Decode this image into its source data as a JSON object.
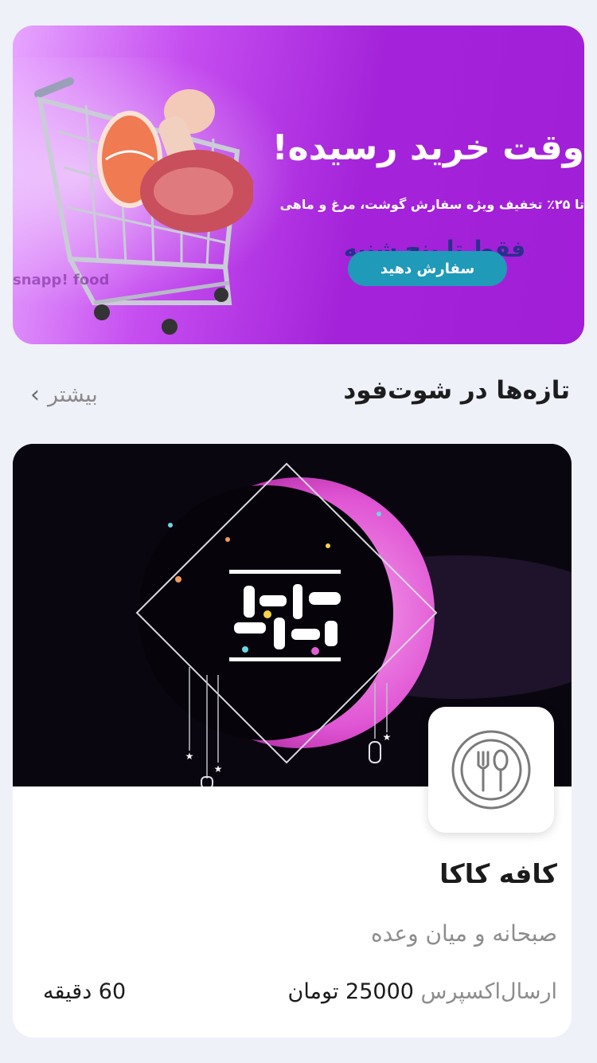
{
  "banner": {
    "headline": "وقت خرید رسیده!",
    "subtitle": "تا ۲۵٪ تخفیف ویژه سفارش گوشت، مرغ و ماهی",
    "date_note": "فقط تا پنج شنبه",
    "cta_label": "سفارش دهید",
    "watermark": "snapp! food"
  },
  "section": {
    "title": "تازه‌ها در شوت‌فود",
    "more_label": "بیشتر"
  },
  "restaurant": {
    "name": "کافه کاکا",
    "category": "صبحانه و میان وعده",
    "delivery_label": "ارسال‌اکسپرس",
    "delivery_fee": "25000 تومان",
    "eta": "60 دقیقه",
    "cover_caption": "رمضان کریم"
  },
  "colors": {
    "banner_purple": "#a423da",
    "cta_teal": "#1f9ab8",
    "moon_pink": "#e055d4"
  }
}
